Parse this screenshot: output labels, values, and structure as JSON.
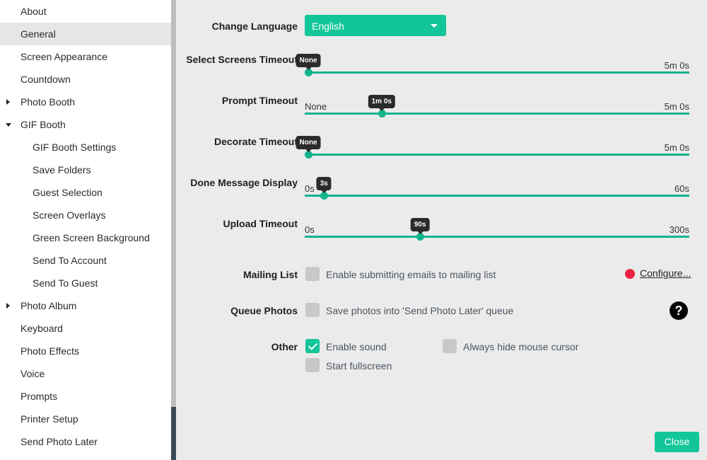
{
  "sidebar": {
    "items": [
      {
        "label": "About"
      },
      {
        "label": "General"
      },
      {
        "label": "Screen Appearance"
      },
      {
        "label": "Countdown"
      },
      {
        "label": "Photo Booth"
      },
      {
        "label": "GIF Booth"
      },
      {
        "label": "GIF Booth Settings"
      },
      {
        "label": "Save Folders"
      },
      {
        "label": "Guest Selection"
      },
      {
        "label": "Screen Overlays"
      },
      {
        "label": "Green Screen Background"
      },
      {
        "label": "Send To Account"
      },
      {
        "label": "Send To Guest"
      },
      {
        "label": "Photo Album"
      },
      {
        "label": "Keyboard"
      },
      {
        "label": "Photo Effects"
      },
      {
        "label": "Voice"
      },
      {
        "label": "Prompts"
      },
      {
        "label": "Printer Setup"
      },
      {
        "label": "Send Photo Later"
      }
    ]
  },
  "language": {
    "label": "Change Language",
    "value": "English"
  },
  "sliders": [
    {
      "label": "Select Screens Timeout",
      "min": "",
      "max": "5m 0s",
      "tooltip": "None",
      "fraction": 0
    },
    {
      "label": "Prompt Timeout",
      "min": "None",
      "max": "5m 0s",
      "tooltip": "1m 0s",
      "fraction": 0.2
    },
    {
      "label": "Decorate Timeout",
      "min": "",
      "max": "5m 0s",
      "tooltip": "None",
      "fraction": 0
    },
    {
      "label": "Done Message Display",
      "min": "0s",
      "max": "60s",
      "tooltip": "3s",
      "fraction": 0.05
    },
    {
      "label": "Upload Timeout",
      "min": "0s",
      "max": "300s",
      "tooltip": "90s",
      "fraction": 0.3
    }
  ],
  "mailing_list": {
    "label": "Mailing List",
    "option": "Enable submitting emails to mailing list",
    "checked": false,
    "configure": "Configure...",
    "status_color": "#ee2244"
  },
  "queue_photos": {
    "label": "Queue Photos",
    "option": "Save photos into 'Send Photo Later' queue",
    "checked": false,
    "help": "?"
  },
  "other": {
    "label": "Other",
    "enable_sound": {
      "label": "Enable sound",
      "checked": true
    },
    "hide_cursor": {
      "label": "Always hide mouse cursor",
      "checked": false
    },
    "fullscreen": {
      "label": "Start fullscreen",
      "checked": false
    }
  },
  "close_label": "Close",
  "colors": {
    "accent": "#12c69a",
    "sidebar_selected": "#e6e6e6"
  }
}
